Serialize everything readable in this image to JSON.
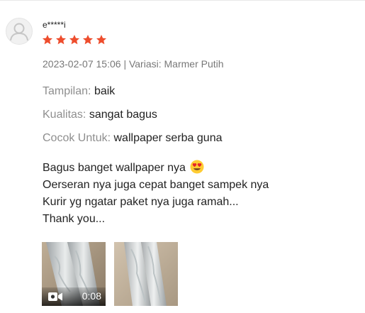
{
  "review": {
    "username": "e*****i",
    "rating": 5,
    "rating_max": 5,
    "star_color": "#ee4d2d",
    "date": "2023-02-07 15:06",
    "separator": "|",
    "variation_label": "Variasi:",
    "variation_value": "Marmer Putih",
    "attributes": [
      {
        "label": "Tampilan:",
        "value": "baik"
      },
      {
        "label": "Kualitas:",
        "value": "sangat bagus"
      },
      {
        "label": "Cocok Untuk:",
        "value": "wallpaper serba guna"
      }
    ],
    "comment_lines": [
      "Bagus banget wallpaper nya",
      "Oerseran nya juga cepat banget sampek nya",
      "Kurir yg ngatar paket nya juga ramah...",
      "Thank you..."
    ],
    "comment_emoji": "heart-eyes-emoji",
    "media": [
      {
        "type": "video",
        "duration": "0:08",
        "icon": "video-camera-icon"
      },
      {
        "type": "image"
      }
    ]
  }
}
